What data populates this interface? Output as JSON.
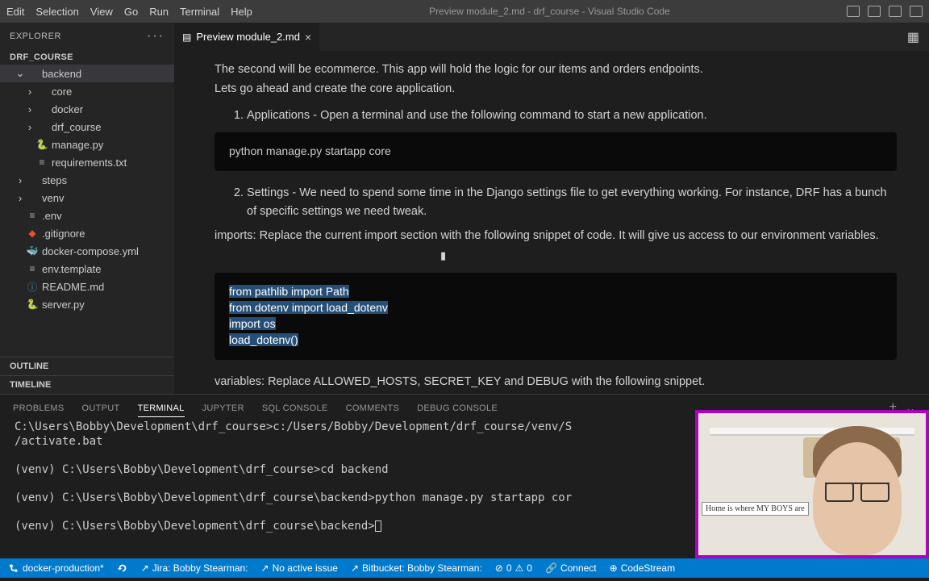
{
  "menu": {
    "items": [
      "Edit",
      "Selection",
      "View",
      "Go",
      "Run",
      "Terminal",
      "Help"
    ],
    "title": "Preview module_2.md - drf_course - Visual Studio Code"
  },
  "explorer": {
    "header": "EXPLORER",
    "root": "DRF_COURSE",
    "tree": [
      {
        "label": "backend",
        "type": "folder",
        "open": true,
        "depth": 1,
        "selected": true
      },
      {
        "label": "core",
        "type": "folder",
        "open": false,
        "depth": 2
      },
      {
        "label": "docker",
        "type": "folder",
        "open": false,
        "depth": 2
      },
      {
        "label": "drf_course",
        "type": "folder",
        "open": false,
        "depth": 2
      },
      {
        "label": "manage.py",
        "type": "py",
        "depth": 2
      },
      {
        "label": "requirements.txt",
        "type": "file",
        "depth": 2
      },
      {
        "label": "steps",
        "type": "folder",
        "open": false,
        "depth": 1
      },
      {
        "label": "venv",
        "type": "folder",
        "open": false,
        "depth": 1
      },
      {
        "label": ".env",
        "type": "file",
        "depth": 1
      },
      {
        "label": ".gitignore",
        "type": "git",
        "depth": 1
      },
      {
        "label": "docker-compose.yml",
        "type": "docker",
        "depth": 1
      },
      {
        "label": "env.template",
        "type": "file",
        "depth": 1
      },
      {
        "label": "README.md",
        "type": "md",
        "depth": 1
      },
      {
        "label": "server.py",
        "type": "py",
        "depth": 1
      }
    ],
    "outline": "OUTLINE",
    "timeline": "TIMELINE"
  },
  "tabs": {
    "current": {
      "icon": "📄",
      "label": "Preview module_2.md"
    }
  },
  "preview": {
    "p1": "The second will be ecommerce. This app will hold the logic for our items and orders endpoints.",
    "p2": "Lets go ahead and create the core application.",
    "li1": "Applications - Open a terminal and use the following command to start a new application.",
    "code1": "python manage.py startapp core",
    "li2": "Settings - We need to spend some time in the Django settings file to get everything working. For instance, DRF has a bunch of specific settings we need tweak.",
    "p3": "imports: Replace the current import section with the following snippet of code. It will give us access to our environment variables.",
    "code2_sel_l1": "from pathlib import Path ",
    "code2_sel_l2": "from dotenv import load_dotenv ",
    "code2_sel_l3": "import os ",
    "code2_sel_l4": "load_dotenv()",
    "p4": "variables: Replace ALLOWED_HOSTS, SECRET_KEY and DEBUG with the following snippet."
  },
  "panel": {
    "tabs": [
      "PROBLEMS",
      "OUTPUT",
      "TERMINAL",
      "JUPYTER",
      "SQL CONSOLE",
      "COMMENTS",
      "DEBUG CONSOLE"
    ],
    "active": 2,
    "lines": [
      "C:\\Users\\Bobby\\Development\\drf_course>c:/Users/Bobby/Development/drf_course/venv/S",
      "/activate.bat",
      "",
      "(venv) C:\\Users\\Bobby\\Development\\drf_course>cd backend",
      "",
      "(venv) C:\\Users\\Bobby\\Development\\drf_course\\backend>python manage.py startapp cor",
      "",
      "(venv) C:\\Users\\Bobby\\Development\\drf_course\\backend>"
    ]
  },
  "status": {
    "branch": "docker-production*",
    "jira": "Jira: Bobby Stearman:",
    "issue": "No active issue",
    "bitbucket": "Bitbucket: Bobby Stearman:",
    "errors": "0",
    "warnings": "0",
    "connect": "Connect",
    "codestream": "CodeStream"
  },
  "webcam": {
    "sign": "Home is where MY BOYS are"
  }
}
